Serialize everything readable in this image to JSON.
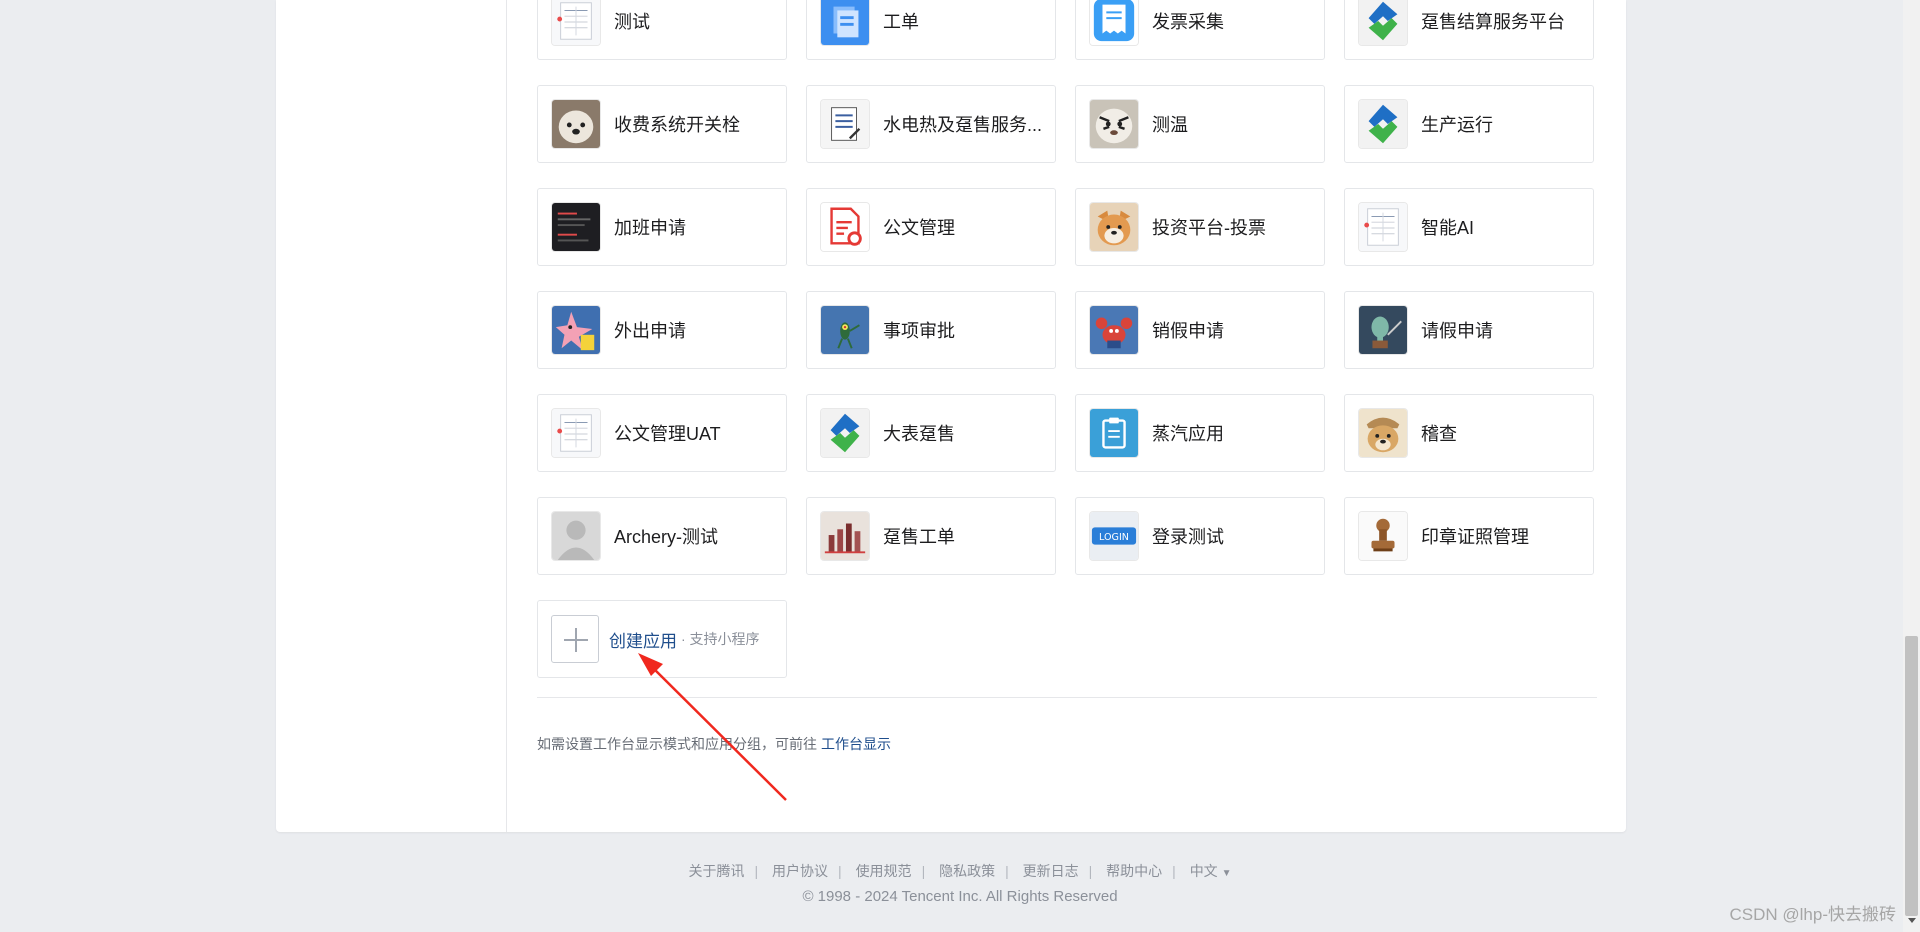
{
  "apps": [
    {
      "name": "测试",
      "icon": "form-doc-icon"
    },
    {
      "name": "工单",
      "icon": "blue-doc-icon"
    },
    {
      "name": "发票采集",
      "icon": "receipt-icon"
    },
    {
      "name": "趸售结算服务平台",
      "icon": "green-logo-icon"
    },
    {
      "name": "收费系统开关栓",
      "icon": "dog-photo-icon"
    },
    {
      "name": "水电热及趸售服务...",
      "icon": "paper-doc-icon"
    },
    {
      "name": "测温",
      "icon": "tiger-photo-icon"
    },
    {
      "name": "生产运行",
      "icon": "green-logo-icon"
    },
    {
      "name": "加班申请",
      "icon": "dark-screenshot-icon"
    },
    {
      "name": "公文管理",
      "icon": "red-doc-gear-icon"
    },
    {
      "name": "投资平台-投票",
      "icon": "shiba-photo-icon"
    },
    {
      "name": "智能AI",
      "icon": "form-doc-icon"
    },
    {
      "name": "外出申请",
      "icon": "patrick-icon"
    },
    {
      "name": "事项审批",
      "icon": "plankton-icon"
    },
    {
      "name": "销假申请",
      "icon": "crab-icon"
    },
    {
      "name": "请假申请",
      "icon": "squidward-icon"
    },
    {
      "name": "公文管理UAT",
      "icon": "form-doc-icon"
    },
    {
      "name": "大表趸售",
      "icon": "green-logo-icon"
    },
    {
      "name": "蒸汽应用",
      "icon": "clipboard-icon"
    },
    {
      "name": "稽查",
      "icon": "dog-hat-photo-icon"
    },
    {
      "name": "Archery-测试",
      "icon": "avatar-placeholder-icon"
    },
    {
      "name": "趸售工单",
      "icon": "chart-photo-icon"
    },
    {
      "name": "登录测试",
      "icon": "login-icon"
    },
    {
      "name": "印章证照管理",
      "icon": "stamp-icon"
    }
  ],
  "create": {
    "label": "创建应用",
    "sub": "· 支持小程序"
  },
  "tip": {
    "text": "如需设置工作台显示模式和应用分组，可前往",
    "link": "工作台显示"
  },
  "footer": {
    "links": [
      "关于腾讯",
      "用户协议",
      "使用规范",
      "隐私政策",
      "更新日志",
      "帮助中心"
    ],
    "language": "中文",
    "copyright": "© 1998 - 2024 Tencent Inc. All Rights Reserved"
  },
  "watermark": "CSDN @lhp-快去搬砖",
  "colors": {
    "link": "#1f4e8c",
    "arrow": "#f0281e",
    "background": "#ebedf0"
  }
}
